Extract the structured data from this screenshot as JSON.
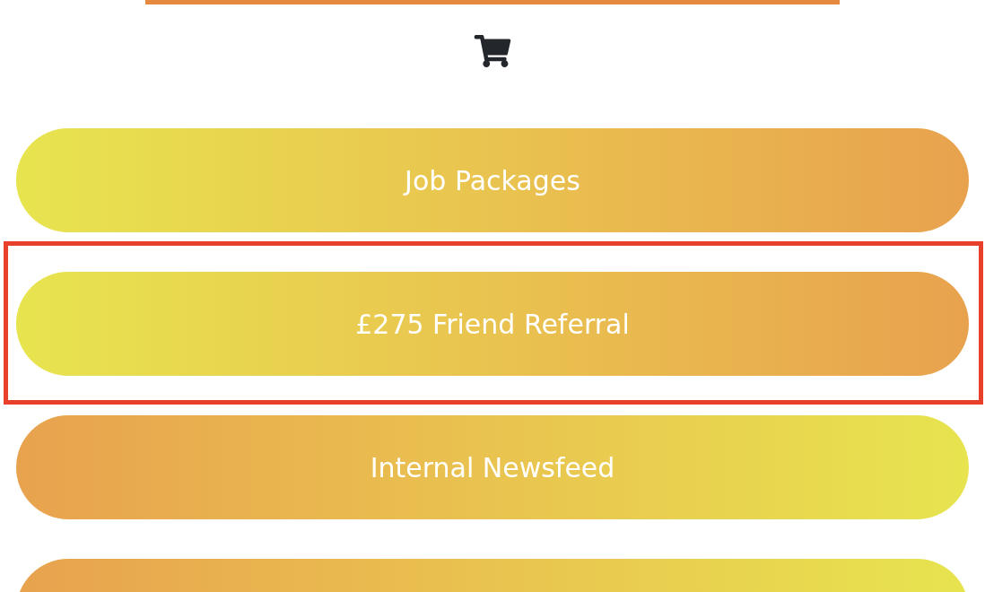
{
  "menu": [
    {
      "label": "Job Packages",
      "reversed": false,
      "highlighted": false
    },
    {
      "label": "£275 Friend Referral",
      "reversed": false,
      "highlighted": true
    },
    {
      "label": "Internal Newsfeed",
      "reversed": true,
      "highlighted": false
    },
    {
      "reversed": true,
      "highlighted": false
    }
  ]
}
